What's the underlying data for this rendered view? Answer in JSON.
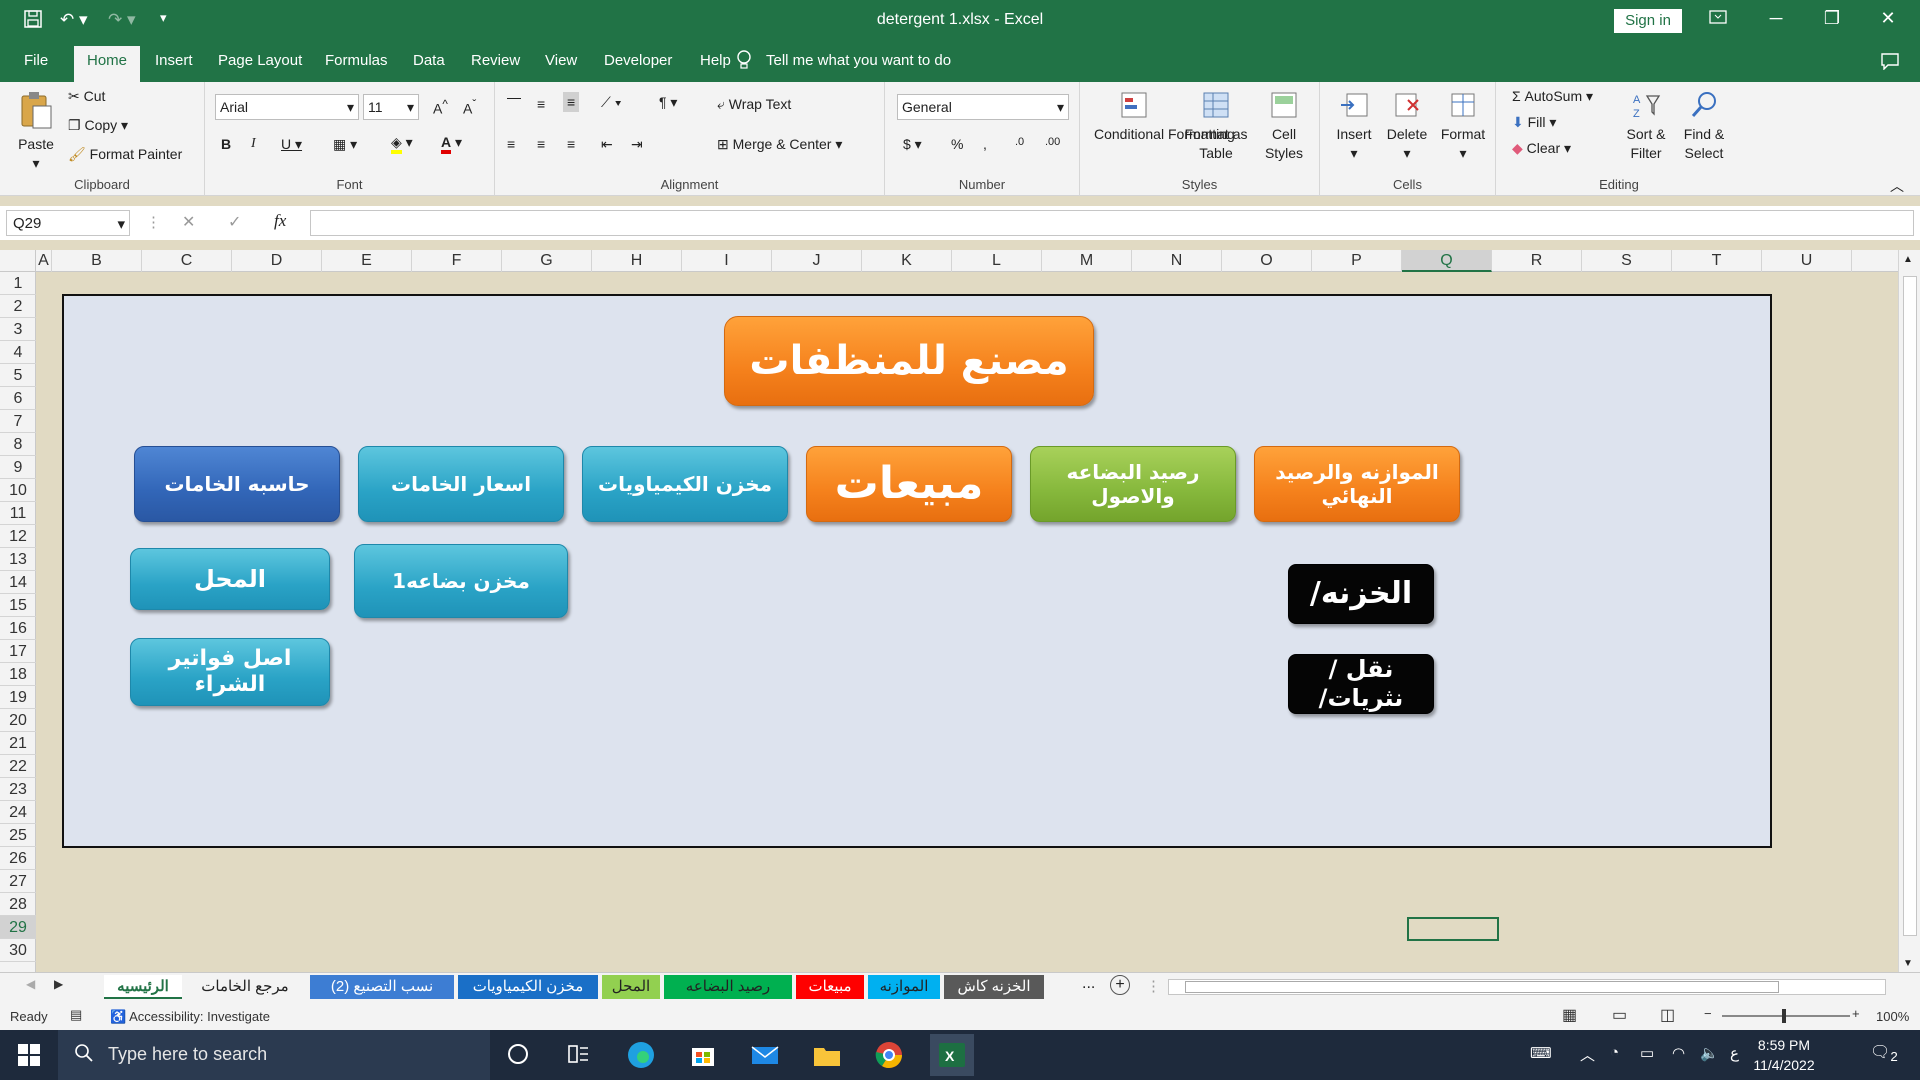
{
  "window": {
    "title": "detergent 1.xlsx  -  Excel",
    "signin": "Sign in"
  },
  "tabs": [
    "File",
    "Home",
    "Insert",
    "Page Layout",
    "Formulas",
    "Data",
    "Review",
    "View",
    "Developer",
    "Help"
  ],
  "tell_me": "Tell me what you want to do",
  "ribbon": {
    "clipboard": {
      "paste": "Paste",
      "cut": "Cut",
      "copy": "Copy",
      "format_painter": "Format Painter",
      "label": "Clipboard"
    },
    "font": {
      "name": "Arial",
      "size": "11",
      "label": "Font"
    },
    "alignment": {
      "wrap": "Wrap Text",
      "merge": "Merge & Center",
      "label": "Alignment"
    },
    "number": {
      "format": "General",
      "label": "Number"
    },
    "styles": {
      "conditional": "Conditional Formatting",
      "format_table": "Format as Table",
      "cell_styles": "Cell Styles",
      "label": "Styles"
    },
    "cells": {
      "insert": "Insert",
      "delete": "Delete",
      "format": "Format",
      "label": "Cells"
    },
    "editing": {
      "autosum": "AutoSum",
      "fill": "Fill",
      "clear": "Clear",
      "sort": "Sort & Filter",
      "find": "Find & Select",
      "label": "Editing"
    }
  },
  "formula_bar": {
    "name_box": "Q29",
    "fx": "fx",
    "value": ""
  },
  "columns": [
    "A",
    "B",
    "C",
    "D",
    "E",
    "F",
    "G",
    "H",
    "I",
    "J",
    "K",
    "L",
    "M",
    "N",
    "O",
    "P",
    "Q",
    "R",
    "S",
    "T",
    "U"
  ],
  "selected_column": "Q",
  "rows": [
    "1",
    "2",
    "3",
    "4",
    "5",
    "6",
    "7",
    "8",
    "9",
    "10",
    "11",
    "12",
    "13",
    "14",
    "15",
    "16",
    "17",
    "18",
    "19",
    "20",
    "21",
    "22",
    "23",
    "24",
    "25",
    "26",
    "27",
    "28",
    "29",
    "30"
  ],
  "selected_row": "29",
  "dashboard": {
    "title": "مصنع للمنظفات",
    "buttons": {
      "calc": "حاسبه الخامات",
      "prices": "اسعار الخامات",
      "chem_store": "مخزن الكيمياويات",
      "sales": "مبيعات",
      "stock_balance": "رصيد البضاعه والاصول",
      "budget": "الموازنه والرصيد النهائي",
      "shop": "المحل",
      "goods_store": "مخزن بضاعه1",
      "invoices": "اصل فواتير الشراء",
      "treasury": "الخزنه/",
      "transport": "نقل /نثريات/"
    }
  },
  "sheet_tabs": [
    "الرئيسيه",
    "مرجع الخامات",
    "نسب التصنيع (2)",
    "مخزن الكيمياويات",
    "المحل",
    "رصيد البضاعه",
    "مبيعات",
    "الموازنه",
    "الخزنه كاش"
  ],
  "sheet_more": "...",
  "status": {
    "ready": "Ready",
    "accessibility": "Accessibility: Investigate",
    "zoom": "100%"
  },
  "taskbar": {
    "search": "Type here to search",
    "time": "8:59 PM",
    "date": "11/4/2022",
    "notif": "2"
  },
  "colors": {
    "excel_green": "#217346",
    "teal": "#2aa3c6",
    "orange": "#f5811c",
    "blue": "#3266b8",
    "green": "#86b83c"
  }
}
